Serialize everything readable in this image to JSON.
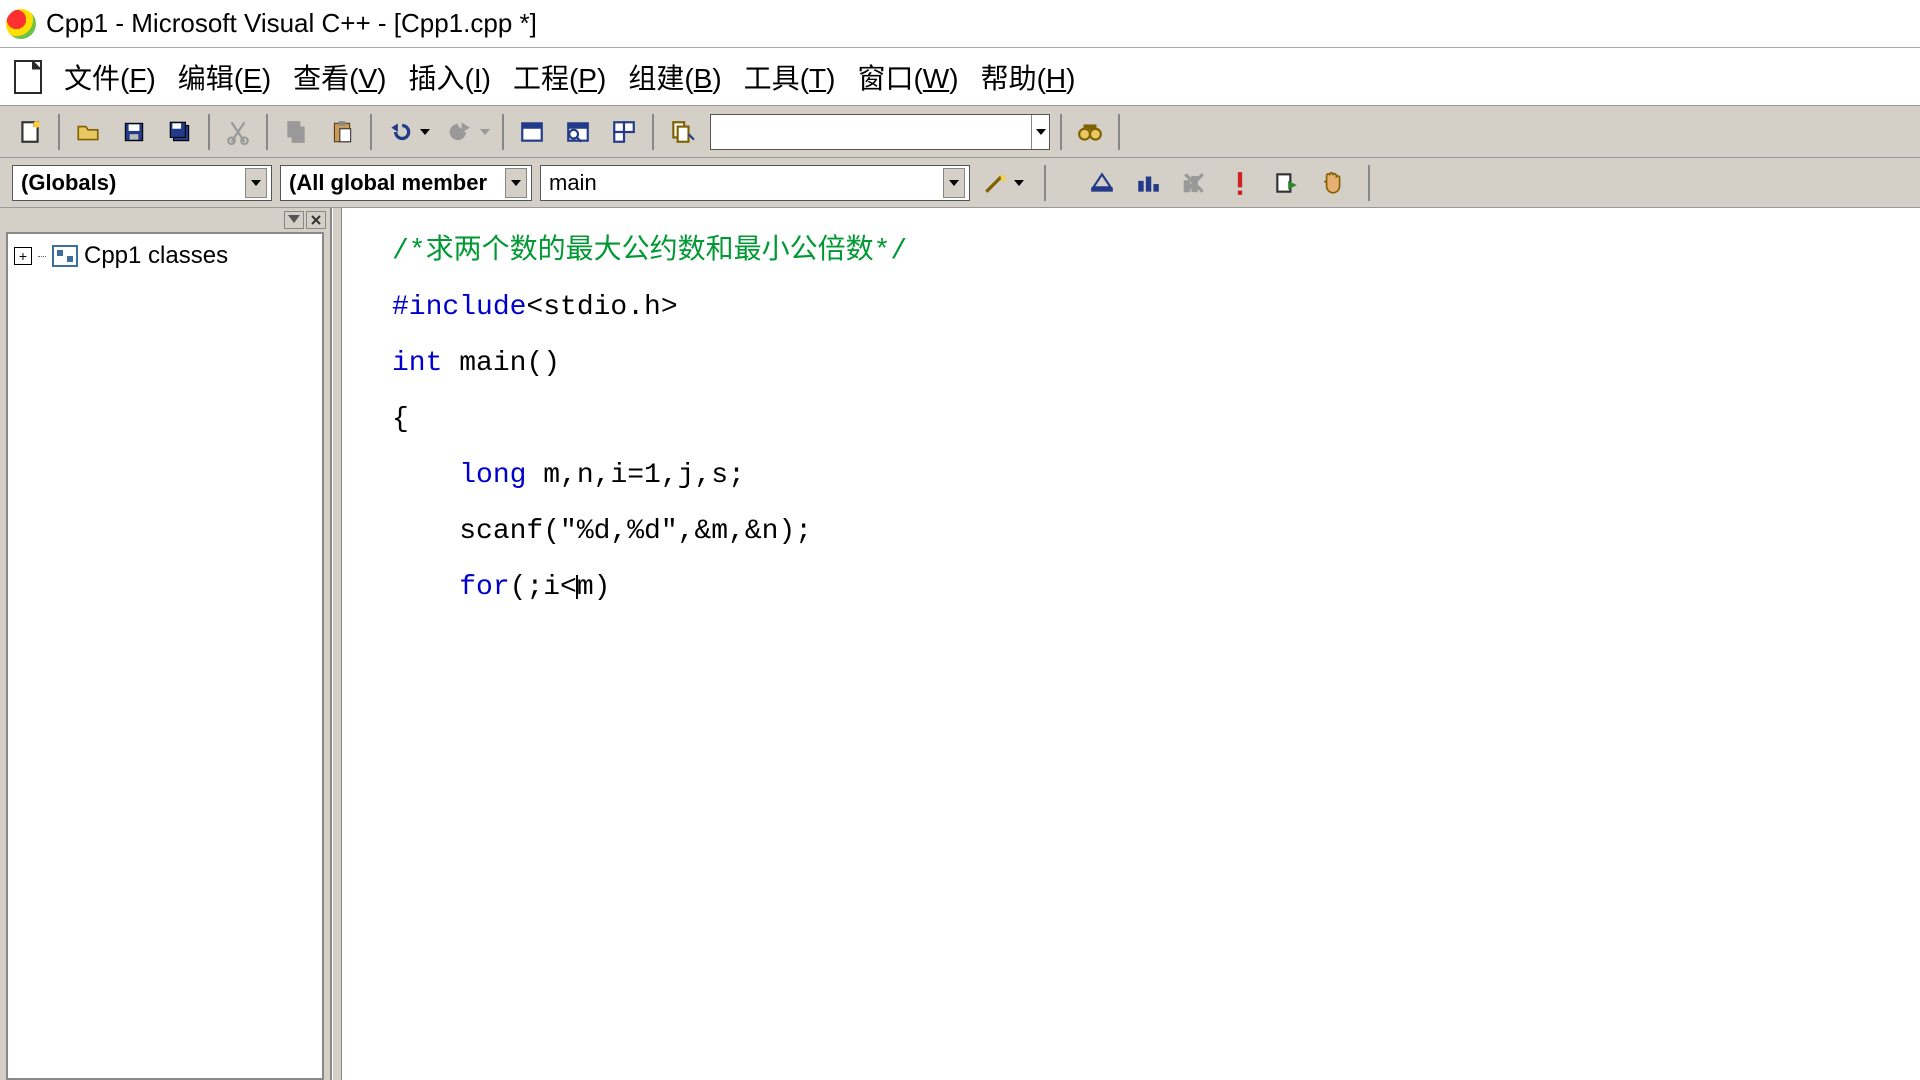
{
  "title": "Cpp1 - Microsoft Visual C++ - [Cpp1.cpp *]",
  "menu": {
    "file": {
      "label": "文件",
      "hotkey": "F"
    },
    "edit": {
      "label": "编辑",
      "hotkey": "E"
    },
    "view": {
      "label": "查看",
      "hotkey": "V"
    },
    "insert": {
      "label": "插入",
      "hotkey": "I"
    },
    "project": {
      "label": "工程",
      "hotkey": "P"
    },
    "build": {
      "label": "组建",
      "hotkey": "B"
    },
    "tools": {
      "label": "工具",
      "hotkey": "T"
    },
    "window": {
      "label": "窗口",
      "hotkey": "W"
    },
    "help": {
      "label": "帮助",
      "hotkey": "H"
    }
  },
  "search_value": "",
  "scope_combo": "(Globals)",
  "members_combo": "(All global member",
  "function_combo": "main",
  "tree_root": "Cpp1 classes",
  "code": {
    "l1_comment": "/*求两个数的最大公约数和最小公倍数*/",
    "l2_a": "#include",
    "l2_b": "<stdio.h>",
    "l3_a": "int",
    "l3_b": " main()",
    "l4": "{",
    "l5_a": "long",
    "l5_b": " m,n,i=1,j,s;",
    "l6": "scanf(\"%d,%d\",&m,&n);",
    "l7_a": "for",
    "l7_b": "(;i<",
    "l7_c": "m)"
  }
}
